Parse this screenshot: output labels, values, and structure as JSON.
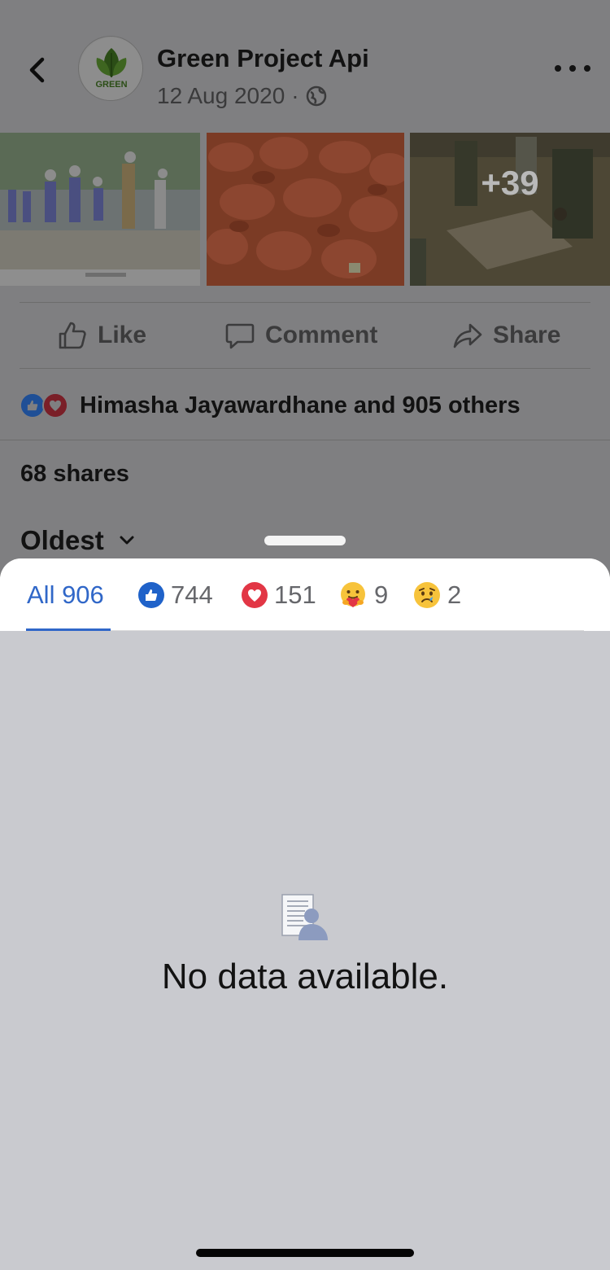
{
  "post": {
    "page_name": "Green Project Api",
    "date": "12 Aug 2020",
    "separator": "·",
    "avatar_text": "GREEN",
    "more_photos_count": "+39",
    "actions": {
      "like": "Like",
      "comment": "Comment",
      "share": "Share"
    },
    "reactions_summary": "Himasha Jayawardhane and 905 others",
    "shares": "68 shares",
    "sort_label": "Oldest"
  },
  "sheet": {
    "tabs": [
      {
        "label": "All 906",
        "count": "906",
        "selected": true
      },
      {
        "label": "Like",
        "count": "744",
        "icon": "like-icon"
      },
      {
        "label": "Love",
        "count": "151",
        "icon": "love-icon"
      },
      {
        "label": "Care",
        "count": "9",
        "icon": "care-icon"
      },
      {
        "label": "Sad",
        "count": "2",
        "icon": "sad-icon"
      }
    ],
    "empty_message": "No data available."
  },
  "colors": {
    "accent": "#3067c8",
    "overlay_background": "#7f7f81",
    "empty_background": "#c9cacf",
    "like_blue": "#1f62c9",
    "love_red": "#e23645"
  }
}
